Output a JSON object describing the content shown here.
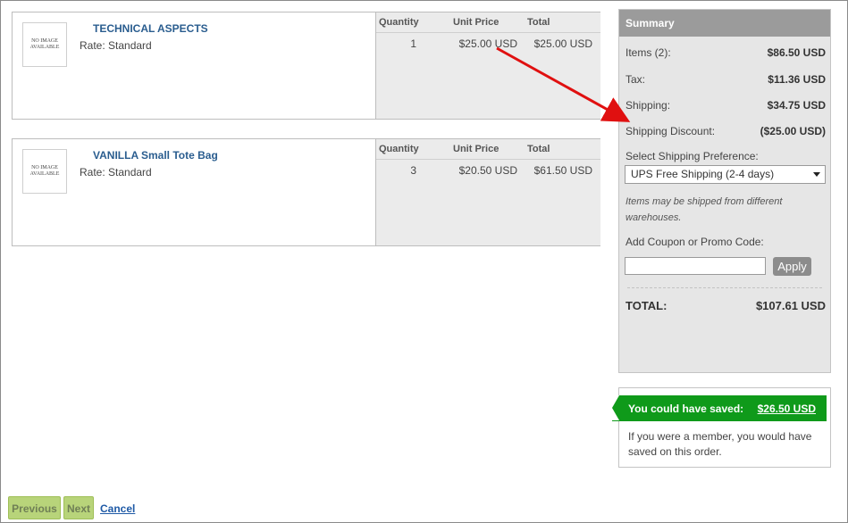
{
  "items": [
    {
      "name": "TECHNICAL ASPECTS",
      "rate": "Rate: Standard",
      "image_text": "NO IMAGE AVAILABLE",
      "headers": {
        "quantity": "Quantity",
        "unit_price": "Unit Price",
        "total": "Total"
      },
      "quantity": "1",
      "unit_price": "$25.00 USD",
      "total": "$25.00 USD"
    },
    {
      "name": "VANILLA Small Tote Bag",
      "rate": "Rate: Standard",
      "image_text": "NO IMAGE AVAILABLE",
      "headers": {
        "quantity": "Quantity",
        "unit_price": "Unit Price",
        "total": "Total"
      },
      "quantity": "3",
      "unit_price": "$20.50 USD",
      "total": "$61.50 USD"
    }
  ],
  "summary": {
    "title": "Summary",
    "items_label": "Items (2):",
    "items_value": "$86.50 USD",
    "tax_label": "Tax:",
    "tax_value": "$11.36 USD",
    "shipping_label": "Shipping:",
    "shipping_value": "$34.75 USD",
    "discount_label": "Shipping Discount:",
    "discount_value": "($25.00 USD)",
    "shipping_pref_label": "Select Shipping Preference:",
    "shipping_pref_value": "UPS Free Shipping (2-4 days)",
    "shipping_note": "Items may be shipped from different warehouses.",
    "coupon_label": "Add Coupon or Promo Code:",
    "coupon_value": "",
    "apply_label": "Apply",
    "total_label": "TOTAL:",
    "total_value": "$107.61 USD"
  },
  "savings": {
    "banner_text": "You could have saved:",
    "amount": "$26.50 USD",
    "note": "If you were a member, you would have saved on this order.",
    "banner_color": "#0f9a1a"
  },
  "nav": {
    "previous_label": "Previous",
    "next_label": "Next",
    "cancel_label": "Cancel"
  },
  "annotation": {
    "arrow_color": "#e01010"
  }
}
